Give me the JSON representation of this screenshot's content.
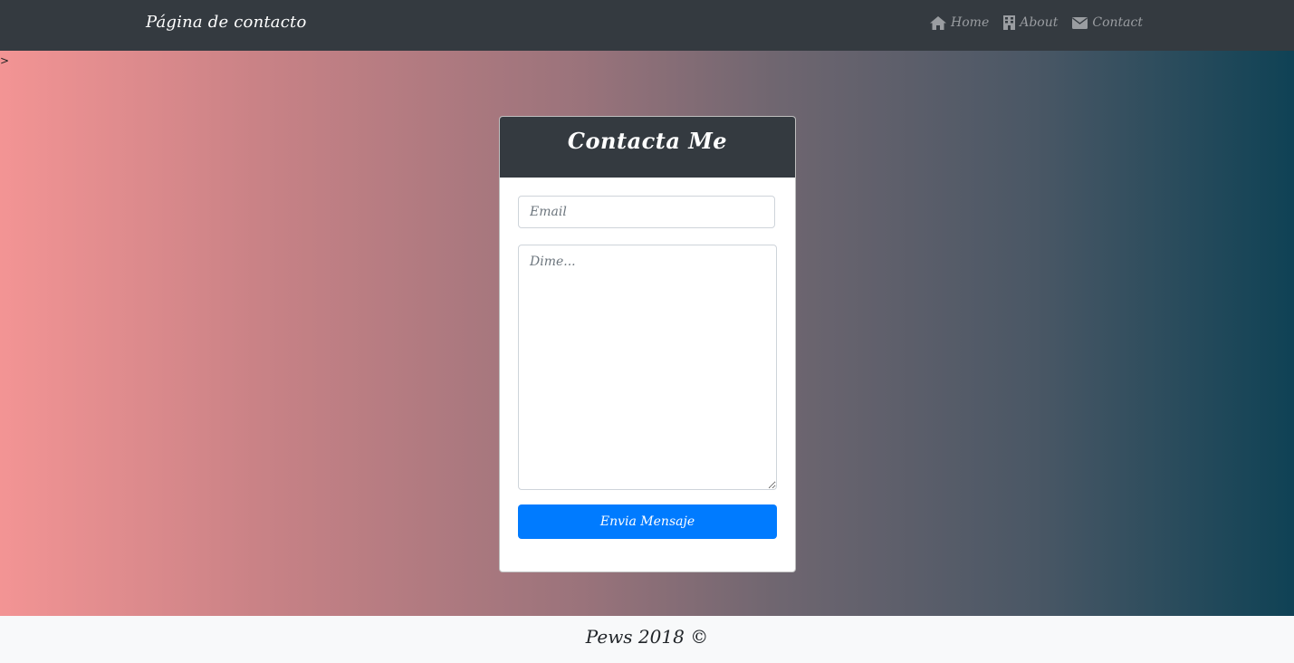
{
  "navbar": {
    "brand": "Página de contacto",
    "links": [
      {
        "label": "Home",
        "icon": "home-icon"
      },
      {
        "label": "About",
        "icon": "building-icon"
      },
      {
        "label": "Contact",
        "icon": "envelope-icon"
      }
    ]
  },
  "main": {
    "stray_text": ">"
  },
  "card": {
    "title": "Contacta Me",
    "email_placeholder": "Email",
    "message_placeholder": "Dime...",
    "submit_label": "Envia Mensaje"
  },
  "footer": {
    "text": "Pews 2018 ©"
  },
  "colors": {
    "navbar_bg": "#343a40",
    "button_bg": "#007bff",
    "gradient_start": "#f39494",
    "gradient_end": "#0f4255"
  }
}
